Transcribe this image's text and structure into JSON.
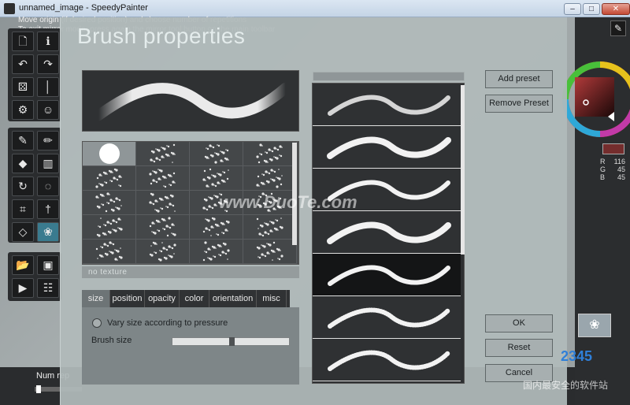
{
  "window": {
    "title": "unnamed_image - SpeedyPainter",
    "min": "–",
    "max": "□",
    "close": "✕"
  },
  "hint": {
    "line1": "Move origin (if desired position) and choose number of repetitions",
    "line2": "To exit mirror mode, press again the mirror tool button on the main toolbar"
  },
  "toolbar_top": [
    {
      "icon": "document-icon",
      "glyph": "🗋"
    },
    {
      "icon": "info-icon",
      "glyph": "ℹ"
    },
    {
      "icon": "undo-icon",
      "glyph": "↶"
    },
    {
      "icon": "redo-icon",
      "glyph": "↷"
    },
    {
      "icon": "dice-icon",
      "glyph": "⚄"
    },
    {
      "icon": "mirror-icon",
      "glyph": "│"
    },
    {
      "icon": "settings-icon",
      "glyph": "⚙"
    },
    {
      "icon": "people-icon",
      "glyph": "☺"
    }
  ],
  "toolbar_mid": [
    {
      "icon": "brush-icon",
      "glyph": "✎"
    },
    {
      "icon": "pencil-icon",
      "glyph": "✏"
    },
    {
      "icon": "fill-bucket-icon",
      "glyph": "◆"
    },
    {
      "icon": "gradient-icon",
      "glyph": "▥"
    },
    {
      "icon": "rotate-icon",
      "glyph": "↻"
    },
    {
      "icon": "lasso-icon",
      "glyph": "◌"
    },
    {
      "icon": "crop-icon",
      "glyph": "⌗"
    },
    {
      "icon": "eyedropper-icon",
      "glyph": "†"
    },
    {
      "icon": "symmetry-icon",
      "glyph": "◇"
    },
    {
      "icon": "brain-icon",
      "glyph": "❀"
    }
  ],
  "toolbar_bottom": [
    {
      "icon": "open-folder-icon",
      "glyph": "📂"
    },
    {
      "icon": "save-icon",
      "glyph": "▣"
    },
    {
      "icon": "play-icon",
      "glyph": "▶"
    },
    {
      "icon": "clapper-icon",
      "glyph": "☷"
    }
  ],
  "dialog": {
    "title": "Brush properties",
    "no_texture": "no texture",
    "tabs": [
      "size",
      "position",
      "opacity",
      "color",
      "orientation",
      "misc"
    ],
    "active_tab": "size",
    "vary_size_label": "Vary size according to pressure",
    "brush_size_label": "Brush size",
    "brush_size_value": 0.5,
    "buttons": {
      "add_preset": "Add preset",
      "remove_preset": "Remove Preset",
      "ok": "OK",
      "reset": "Reset",
      "cancel": "Cancel"
    }
  },
  "color": {
    "current": "#742d2d",
    "r_label": "R",
    "r": "116",
    "g_label": "G",
    "g": "45",
    "b_label": "B",
    "b": "45"
  },
  "bottom": {
    "num_rep_label": "Num rep"
  },
  "watermarks": {
    "main": "www.DuoTe.com",
    "bottom": "国内最安全的软件站",
    "logo": "2345"
  }
}
